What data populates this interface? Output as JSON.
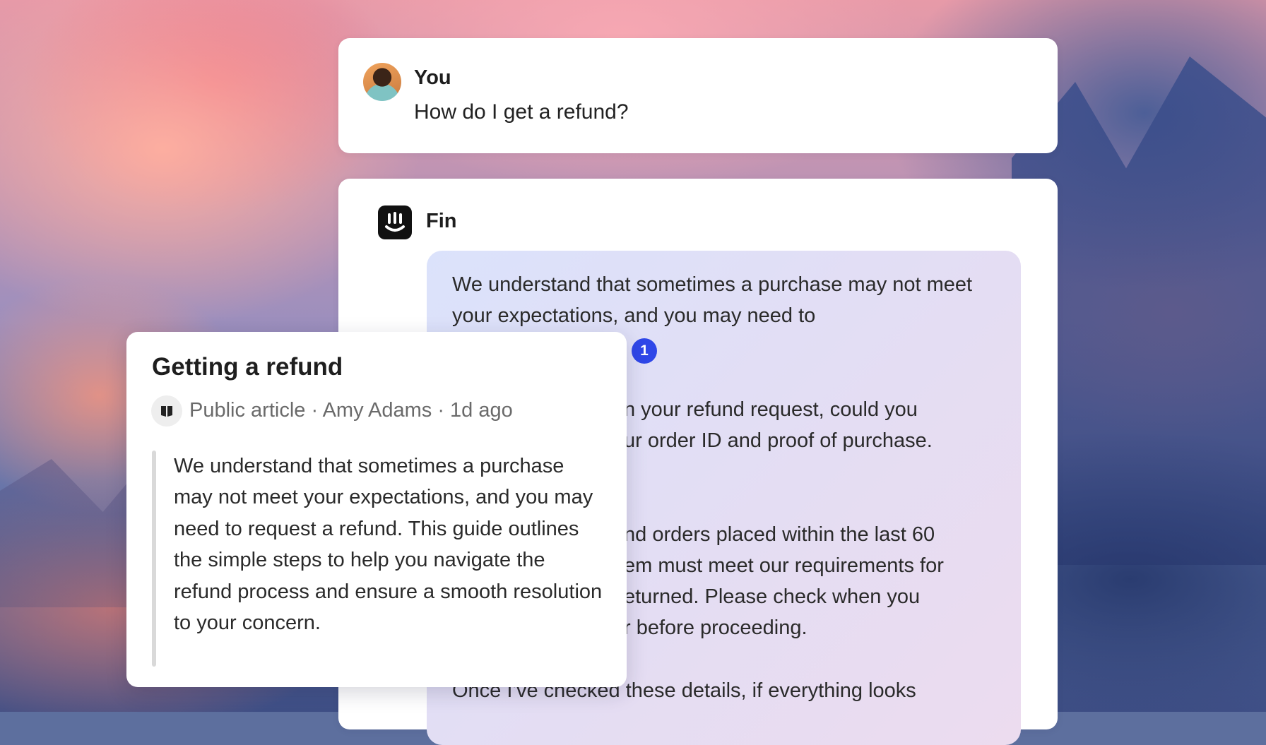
{
  "user_message": {
    "sender": "You",
    "text": "How do I get a refund?"
  },
  "fin_message": {
    "sender": "Fin",
    "paragraphs": [
      "We understand that sometimes a purchase may not meet your expectations, and you may need to",
      "n your refund request, could you\nur order ID and proof of purchase.",
      "nd orders placed within the last 60\nem must meet our requirements for\neturned. Please check when you\nr before proceeding.",
      "Once I've checked these details, if everything looks"
    ],
    "citation_number": "1"
  },
  "source_card": {
    "title": "Getting a refund",
    "meta": "Public article · Amy Adams · 1d ago",
    "quote": "We understand that sometimes a purchase may not meet your expectations, and you may need to request a refund. This guide outlines the simple steps to help you navigate the refund process and ensure a smooth resolution to your concern."
  },
  "icons": {
    "avatar": "user-avatar",
    "fin_logo": "fin-logo-icon",
    "article": "book-icon"
  }
}
